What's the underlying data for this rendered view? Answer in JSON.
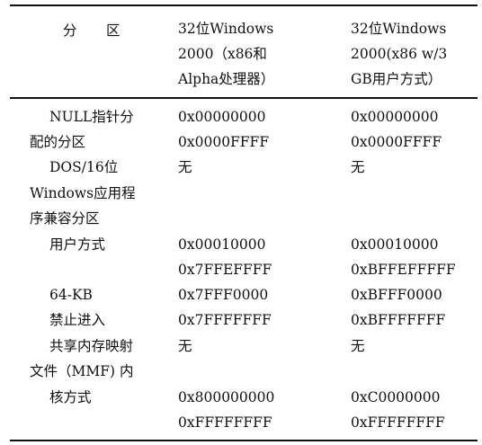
{
  "header": {
    "col1_a": "分",
    "col1_b": "区",
    "col2": [
      "32位Windows",
      "2000（x86和",
      "Alpha处理器）"
    ],
    "col3": [
      "32位Windows",
      "2000(x86 w/3",
      "GB用户方式）"
    ]
  },
  "rows": {
    "null": {
      "label": [
        "NULL指针分",
        "配的分区"
      ],
      "v2": [
        "0x00000000",
        "0x0000FFFF"
      ],
      "v3": [
        "0x00000000",
        "0x0000FFFF"
      ]
    },
    "dos": {
      "label": [
        "DOS/16位",
        "Windows应用程",
        "序兼容分区"
      ],
      "v2": "无",
      "v3": "无"
    },
    "user": {
      "label": "用户方式",
      "v2": [
        "0x00010000",
        "0x7FFEFFFF"
      ],
      "v3": [
        "0x00010000",
        "0xBFFEFFFFF"
      ]
    },
    "kb64": {
      "label": [
        "64-KB",
        "禁止进入"
      ],
      "v2": [
        "0x7FFF0000",
        "0x7FFFFFFF"
      ],
      "v3": [
        "0xBFFF0000",
        "0xBFFFFFFF"
      ]
    },
    "mmf": {
      "label": [
        "共享内存映射",
        "文件（MMF) 内"
      ],
      "v2": "无",
      "v3": "无"
    },
    "kernel": {
      "label": "核方式",
      "v2": [
        "0x800000000",
        "0xFFFFFFFF"
      ],
      "v3": [
        "0xC0000000",
        "0xFFFFFFFF"
      ]
    }
  }
}
